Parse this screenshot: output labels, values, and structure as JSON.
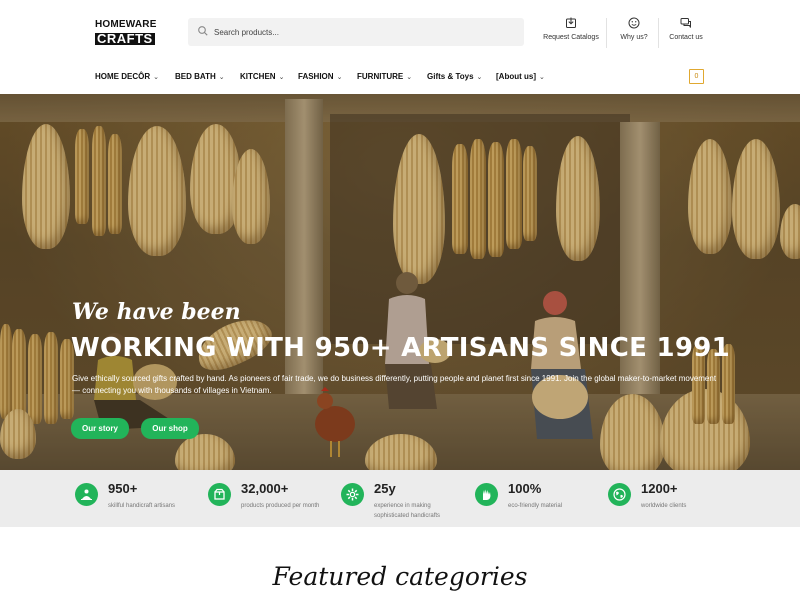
{
  "brand": {
    "line1": "HOMEWARE",
    "line2": "CRAFTS"
  },
  "search": {
    "placeholder": "Search products..."
  },
  "header_links": [
    {
      "label": "Request Catalogs",
      "icon": "catalog-download-icon"
    },
    {
      "label": "Why us?",
      "icon": "smiley-icon"
    },
    {
      "label": "Contact us",
      "icon": "chat-icon"
    }
  ],
  "nav": [
    {
      "label": "HOME DECÔR"
    },
    {
      "label": "BED BATH"
    },
    {
      "label": "KITCHEN"
    },
    {
      "label": "FASHION"
    },
    {
      "label": "FURNITURE"
    },
    {
      "label": "Gifts & Toys"
    },
    {
      "label": "[About us]"
    }
  ],
  "cart": {
    "count": "0"
  },
  "hero": {
    "script": "We have been",
    "title": "WORKING WITH 950+ ARTISANS SINCE 1991",
    "text": "Give ethically sourced gifts crafted by hand. As pioneers of fair trade, we do business differently, putting people and planet first since 1991. Join the global maker-to-market movement — connecting you with thousands of villages in Vietnam.",
    "btn_story": "Our story",
    "btn_shop": "Our shop"
  },
  "stats": [
    {
      "value": "950+",
      "label": "skillful handicraft artisans",
      "icon": "artisan-icon"
    },
    {
      "value": "32,000+",
      "label": "products produced per month",
      "icon": "box-icon"
    },
    {
      "value": "25y",
      "label": "experience in making sophisticated handicrafts",
      "icon": "gear-icon"
    },
    {
      "value": "100%",
      "label": "eco-friendly material",
      "icon": "hand-icon"
    },
    {
      "value": "1200+",
      "label": "worldwide clients",
      "icon": "globe-icon"
    }
  ],
  "featured": {
    "title": "Featured categories"
  },
  "colors": {
    "accent": "#22b45a",
    "cart": "#e0a830"
  }
}
